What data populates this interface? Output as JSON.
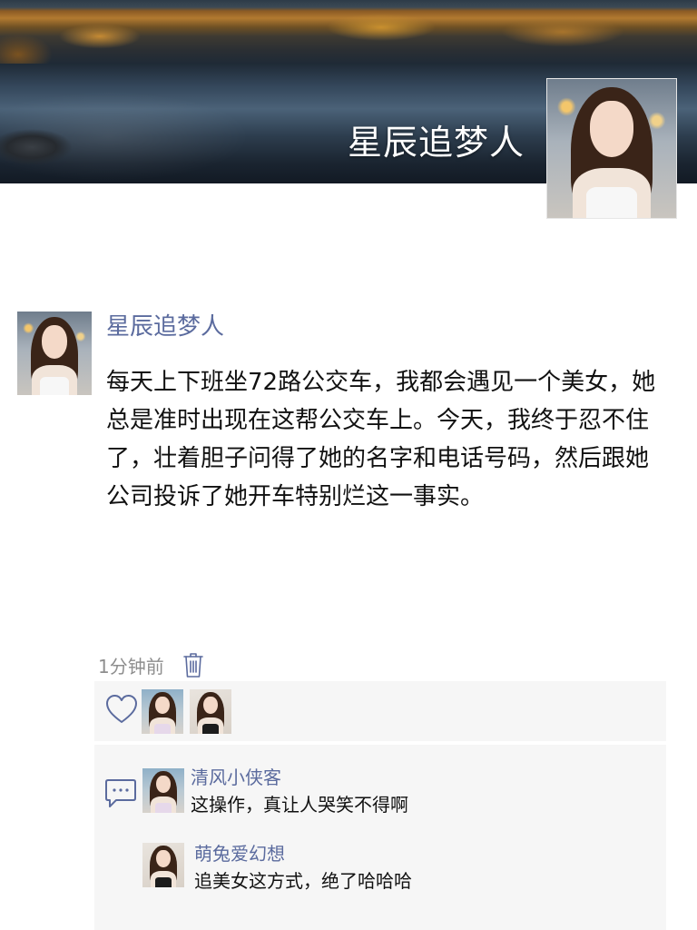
{
  "cover": {
    "title": "星辰追梦人"
  },
  "post": {
    "author": "星辰追梦人",
    "body": "每天上下班坐72路公交车，我都会遇见一个美女，她总是准时出现在这帮公交车上。今天，我终于忍不住了，壮着胆子问得了她的名字和电话号码，然后跟她公司投诉了她开车特别烂这一事实。",
    "time": "1分钟前"
  },
  "likes": {
    "icon": "heart-icon",
    "count": 2
  },
  "comments": [
    {
      "author": "清风小侠客",
      "text": "这操作，真让人哭笑不得啊"
    },
    {
      "author": "萌兔爱幻想",
      "text": "追美女这方式，绝了哈哈哈"
    }
  ],
  "colors": {
    "link": "#5b6b9e",
    "panel": "#f6f6f6",
    "text": "#111111",
    "meta": "#8e8e8e"
  }
}
